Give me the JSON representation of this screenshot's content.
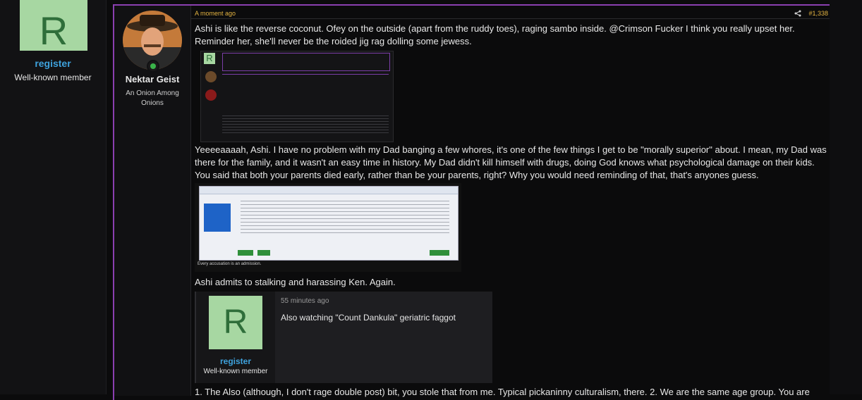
{
  "sidebar_user": {
    "avatar_letter": "R",
    "name": "register",
    "role": "Well-known member"
  },
  "post": {
    "timestamp": "A moment ago",
    "post_number": "#1,338",
    "author": {
      "name": "Nektar Geist",
      "title": "An Onion Among Onions",
      "online": true
    },
    "paragraphs": [
      "Ashi is like the reverse coconut. Ofey on the outside (apart from the ruddy toes), raging sambo inside. @Crimson Fucker I think you really upset her. Reminder her, she'll never be the roided jig rag dolling some jewess.",
      "Yeeeeaaaah, Ashi. I have no problem with my Dad banging a few whores, it's one of the few things I get to be \"morally superior\" about. I mean, my Dad was there for the family, and it wasn't an easy time in history. My Dad didn't kill himself with drugs, doing God knows what psychological damage on their kids. You said that both your parents died early, rather than be your parents, right? Why you would need reminding of that, that's anyones guess.",
      "Ashi admits to stalking and harassing Ken. Again.",
      "1. The Also (although, I don't rage double post) bit, you stole that from me. Typical pickaninny culturalism, there. 2. We are the same age group. You are"
    ],
    "embedded_screenshot_caption": "Every accusation is an admission.",
    "quote": {
      "avatar_letter": "R",
      "user": "register",
      "role": "Well-known member",
      "time": "55 minutes ago",
      "text": "Also watching \"Count Dankula\" geriatric faggot"
    }
  },
  "colors": {
    "accent": "#8a3fb0",
    "timestamp": "#e3b341",
    "username": "#3ea2dd",
    "avatar_bg": "#a7d7a2"
  }
}
